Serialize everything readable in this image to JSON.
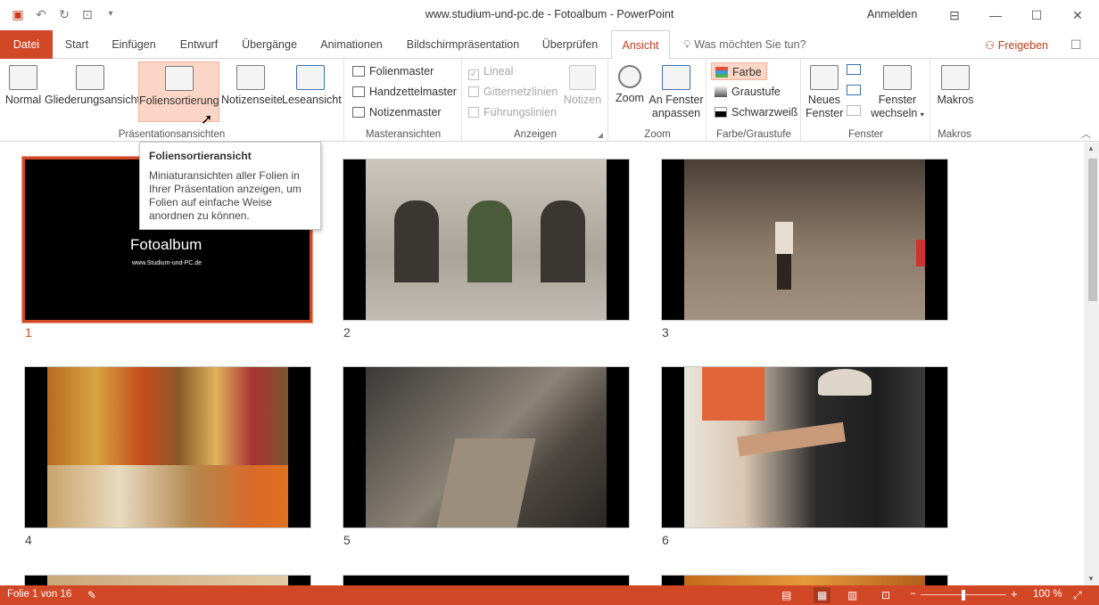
{
  "window": {
    "title": "www.studium-und-pc.de - Fotoalbum  -  PowerPoint",
    "signin": "Anmelden",
    "tellme": "Was möchten Sie tun?",
    "share": "Freigeben"
  },
  "tabs": [
    "Datei",
    "Start",
    "Einfügen",
    "Entwurf",
    "Übergänge",
    "Animationen",
    "Bildschirmpräsentation",
    "Überprüfen",
    "Ansicht"
  ],
  "ribbon": {
    "g1": {
      "label": "Präsentationsansichten",
      "normal": "Normal",
      "outline": "Gliederungsansicht",
      "sorter": "Foliensortierung",
      "notes": "Notizenseite",
      "reading": "Leseansicht"
    },
    "g2": {
      "label": "Masteransichten",
      "slide_master": "Folienmaster",
      "handout_master": "Handzettelmaster",
      "notes_master": "Notizenmaster"
    },
    "g3": {
      "label": "Anzeigen",
      "ruler": "Lineal",
      "gridlines": "Gitternetzlinien",
      "guides": "Führungslinien",
      "notes": "Notizen"
    },
    "g4": {
      "label": "Zoom",
      "zoom": "Zoom",
      "fit1": "An Fenster",
      "fit2": "anpassen"
    },
    "g5": {
      "label": "Farbe/Graustufe",
      "color": "Farbe",
      "gray": "Graustufe",
      "bw": "Schwarzweiß"
    },
    "g6": {
      "label": "Fenster",
      "new1": "Neues",
      "new2": "Fenster",
      "switch1": "Fenster",
      "switch2": "wechseln"
    },
    "g7": {
      "label": "Makros",
      "macros": "Makros"
    }
  },
  "tooltip": {
    "title": "Foliensortieransicht",
    "desc": "Miniaturansichten aller Folien in Ihrer Präsentation anzeigen, um Folien auf einfache Weise anordnen zu können."
  },
  "slides": {
    "s1": {
      "num": "1",
      "title": "Fotoalbum",
      "subtitle": "www.Studium-und-PC.de"
    },
    "s2": {
      "num": "2"
    },
    "s3": {
      "num": "3"
    },
    "s4": {
      "num": "4"
    },
    "s5": {
      "num": "5"
    },
    "s6": {
      "num": "6"
    }
  },
  "status": {
    "slide": "Folie 1 von 16",
    "zoom": "100 %"
  },
  "colors": {
    "accent": "#d24726"
  }
}
